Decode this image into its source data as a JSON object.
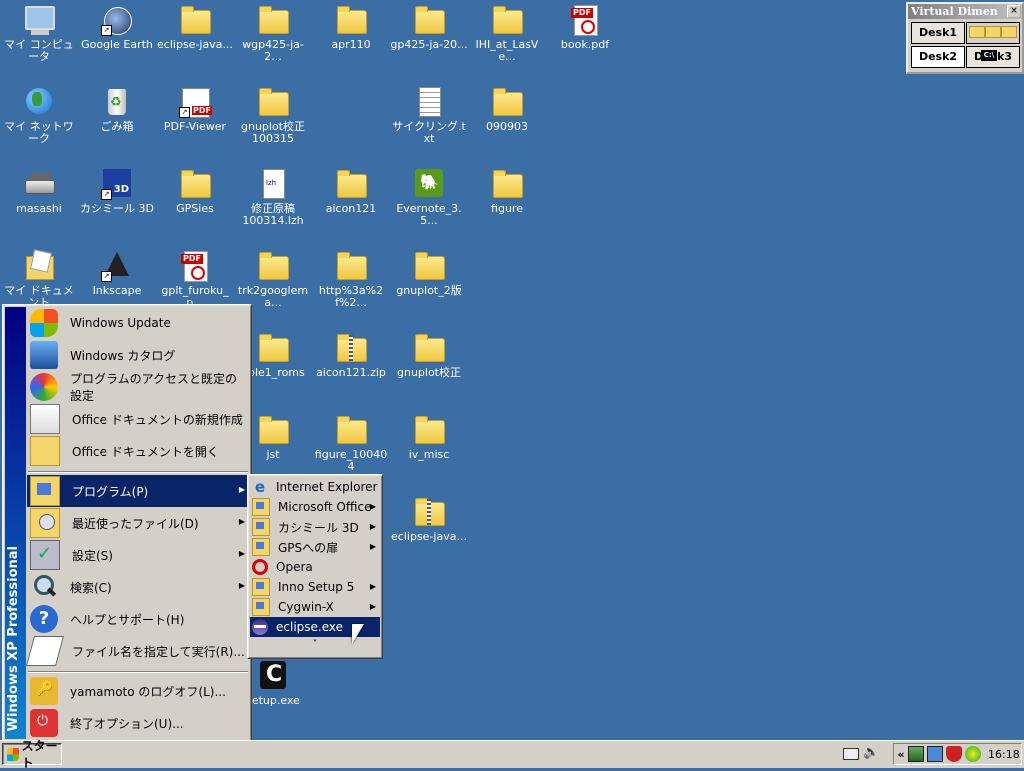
{
  "desktop_icons": [
    {
      "name": "my-computer-icon",
      "label": "マイ コンピュータ",
      "kind": "computer"
    },
    {
      "name": "google-earth-icon",
      "label": "Google Earth",
      "kind": "gearth",
      "shortcut": true
    },
    {
      "name": "folder-icon",
      "label": "eclipse-java...",
      "kind": "folder"
    },
    {
      "name": "folder-icon",
      "label": "wgp425-ja-2...",
      "kind": "folder"
    },
    {
      "name": "folder-icon",
      "label": "apr110",
      "kind": "folder"
    },
    {
      "name": "folder-icon",
      "label": "gp425-ja-20...",
      "kind": "folder"
    },
    {
      "name": "folder-icon",
      "label": "IHI_at_LasVe...",
      "kind": "folder"
    },
    {
      "name": "pdf-file-icon",
      "label": "book.pdf",
      "kind": "pdf"
    },
    {
      "name": "my-network-icon",
      "label": "マイ ネットワーク",
      "kind": "globe"
    },
    {
      "name": "recycle-bin-icon",
      "label": "ごみ箱",
      "kind": "bin"
    },
    {
      "name": "pdf-viewer-icon",
      "label": "PDF-Viewer",
      "kind": "pdfview",
      "shortcut": true
    },
    {
      "name": "folder-icon",
      "label": "gnuplot校正\n100315",
      "kind": "folder"
    },
    {
      "name": "text-file-icon",
      "label": "サイクリング.txt",
      "kind": "txt"
    },
    {
      "name": "folder-icon",
      "label": "090903",
      "kind": "folder"
    },
    {
      "name": "network-drive-icon",
      "label": "masashi",
      "kind": "drive"
    },
    {
      "name": "kashmir-3d-icon",
      "label": "カシミール 3D",
      "kind": "kashmir",
      "shortcut": true
    },
    {
      "name": "folder-icon",
      "label": "GPSies",
      "kind": "folder"
    },
    {
      "name": "archive-file-icon",
      "label": "修正原稿\n100314.lzh",
      "kind": "lzh"
    },
    {
      "name": "folder-icon",
      "label": "aicon121",
      "kind": "folder"
    },
    {
      "name": "evernote-icon",
      "label": "Evernote_3.5...",
      "kind": "evernote"
    },
    {
      "name": "folder-icon",
      "label": "figure",
      "kind": "folder"
    },
    {
      "name": "my-documents-icon",
      "label": "マイ ドキュメント",
      "kind": "mydocs"
    },
    {
      "name": "inkscape-icon",
      "label": "Inkscape",
      "kind": "inkscape",
      "shortcut": true
    },
    {
      "name": "pdf-file-icon",
      "label": "gplt_furoku_p...",
      "kind": "pdf"
    },
    {
      "name": "folder-icon",
      "label": "trk2googlema...",
      "kind": "folder"
    },
    {
      "name": "folder-icon",
      "label": "http%3a%2f%2...",
      "kind": "folder"
    },
    {
      "name": "folder-icon",
      "label": "gnuplot_2版",
      "kind": "folder"
    },
    {
      "name": "folder-icon",
      "label": "ople1_roms",
      "kind": "folder"
    },
    {
      "name": "zip-folder-icon",
      "label": "aicon121.zip",
      "kind": "zip"
    },
    {
      "name": "folder-icon",
      "label": "gnuplot校正",
      "kind": "folder"
    },
    {
      "name": "folder-icon",
      "label": "jst",
      "kind": "folder"
    },
    {
      "name": "folder-icon",
      "label": "figure_100404",
      "kind": "folder"
    },
    {
      "name": "folder-icon",
      "label": "iv_misc",
      "kind": "folder"
    },
    {
      "name": "zip-folder-icon",
      "label": "eclipse-java...",
      "kind": "zip"
    },
    {
      "name": "cygwin-setup-icon",
      "label": "setup.exe",
      "kind": "cygwin"
    }
  ],
  "virtual_dimension": {
    "title": "Virtual Dimen",
    "close": "×",
    "desks": [
      "Desk1",
      "Desk2",
      "Desk3"
    ],
    "console_label": "C:\\"
  },
  "start_menu": {
    "banner": "Windows XP Professional",
    "top_items": [
      {
        "label": "Windows Update",
        "icon": "windows-update-icon"
      },
      {
        "label": "Windows カタログ",
        "icon": "windows-catalog-icon"
      },
      {
        "label": "プログラムのアクセスと既定の設定",
        "icon": "program-access-icon"
      },
      {
        "label": "Office ドキュメントの新規作成",
        "icon": "office-new-document-icon"
      },
      {
        "label": "Office ドキュメントを開く",
        "icon": "office-open-document-icon"
      }
    ],
    "main_items": [
      {
        "label": "プログラム(P)",
        "icon": "programs-icon",
        "submenu": true,
        "highlighted": true
      },
      {
        "label": "最近使ったファイル(D)",
        "icon": "recent-documents-icon",
        "submenu": true
      },
      {
        "label": "設定(S)",
        "icon": "settings-icon",
        "submenu": true
      },
      {
        "label": "検索(C)",
        "icon": "search-icon",
        "submenu": true
      },
      {
        "label": "ヘルプとサポート(H)",
        "icon": "help-icon"
      },
      {
        "label": "ファイル名を指定して実行(R)...",
        "icon": "run-icon"
      }
    ],
    "bottom_items": [
      {
        "label": "yamamoto のログオフ(L)...",
        "icon": "logoff-icon"
      },
      {
        "label": "終了オプション(U)...",
        "icon": "shutdown-icon"
      }
    ]
  },
  "programs_submenu": {
    "items": [
      {
        "label": "Internet Explorer",
        "icon": "internet-explorer-icon"
      },
      {
        "label": "Microsoft Office",
        "icon": "program-folder-icon",
        "submenu": true
      },
      {
        "label": "カシミール 3D",
        "icon": "program-folder-icon",
        "submenu": true
      },
      {
        "label": "GPSへの扉",
        "icon": "program-folder-icon",
        "submenu": true
      },
      {
        "label": "Opera",
        "icon": "opera-icon"
      },
      {
        "label": "Inno Setup 5",
        "icon": "program-folder-icon",
        "submenu": true
      },
      {
        "label": "Cygwin-X",
        "icon": "program-folder-icon",
        "submenu": true
      },
      {
        "label": "eclipse.exe",
        "icon": "eclipse-icon",
        "highlighted": true
      }
    ],
    "more": "˅"
  },
  "taskbar": {
    "start_label": "スタート",
    "tray_chevron": "«",
    "clock": "16:18"
  },
  "colors": {
    "desktop": "#3a6ea5",
    "highlight": "#0a246a",
    "face": "#d4d0c8"
  }
}
